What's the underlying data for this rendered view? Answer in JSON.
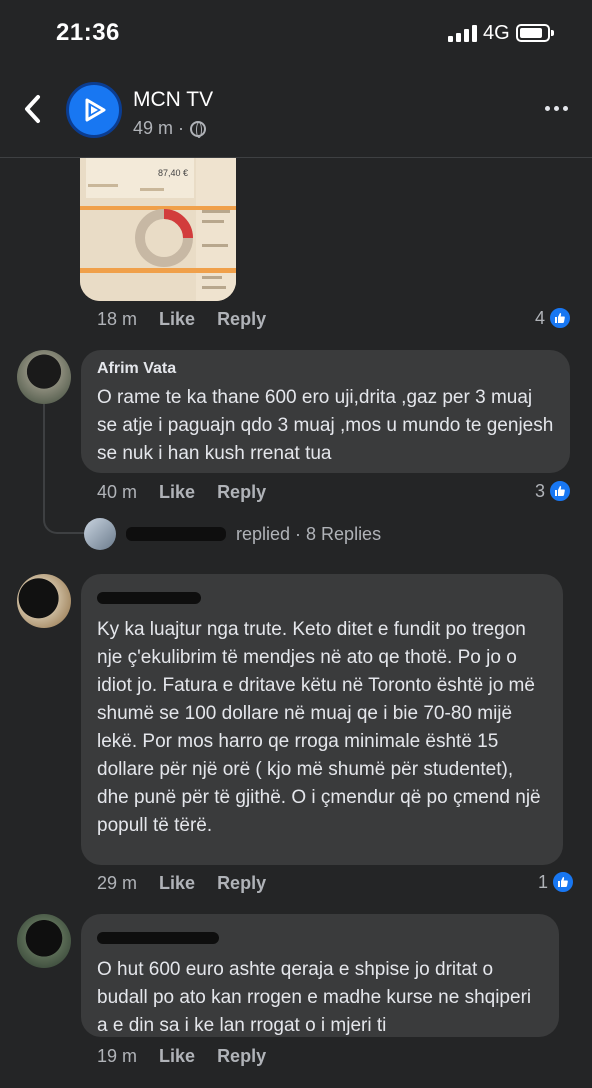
{
  "status": {
    "time": "21:36",
    "network": "4G"
  },
  "post": {
    "page_name": "MCN TV",
    "time_ago": "49 m ·"
  },
  "attachment": {
    "amount": "87,40 €"
  },
  "first_comment": {
    "time": "18 m",
    "like": "Like",
    "reply": "Reply",
    "reactions": "4"
  },
  "comments": [
    {
      "author": "Afrim Vata",
      "text": "O rame te ka thane 600 ero uji,drita ,gaz per 3 muaj se atje i paguajn qdo 3 muaj ,mos u mundo te genjesh se nuk i han kush rrenat tua",
      "time": "40 m",
      "like": "Like",
      "reply": "Reply",
      "reactions": "3"
    },
    {
      "author": "",
      "text": "Ky ka luajtur nga trute. Keto ditet e fundit po tregon nje ç'ekulibrim të mendjes në ato qe thotë. Po jo o idiot jo. Fatura e dritave këtu në Toronto është jo më shumë se 100 dollare në muaj qe i bie 70-80 mijë lekë. Por mos harro qe rroga minimale është 15 dollare për një orë ( kjo më shumë për studentet), dhe punë për të gjithë. O i çmendur që po çmend një popull të tërë.",
      "time": "29 m",
      "like": "Like",
      "reply": "Reply",
      "reactions": "1"
    },
    {
      "author": "",
      "text": "O hut 600 euro ashte qeraja e shpise jo dritat o budall po ato kan rrogen e madhe kurse ne shqiperi a e din sa i ke lan rrogat o i mjeri ti",
      "time": "19 m",
      "like": "Like",
      "reply": "Reply",
      "reactions": ""
    }
  ],
  "replies_summary": {
    "text": "replied · 8 Replies"
  },
  "colors": {
    "background": "#242526",
    "bubble": "#3a3b3c",
    "accent": "#1877f2",
    "muted": "#b0b3b8"
  }
}
